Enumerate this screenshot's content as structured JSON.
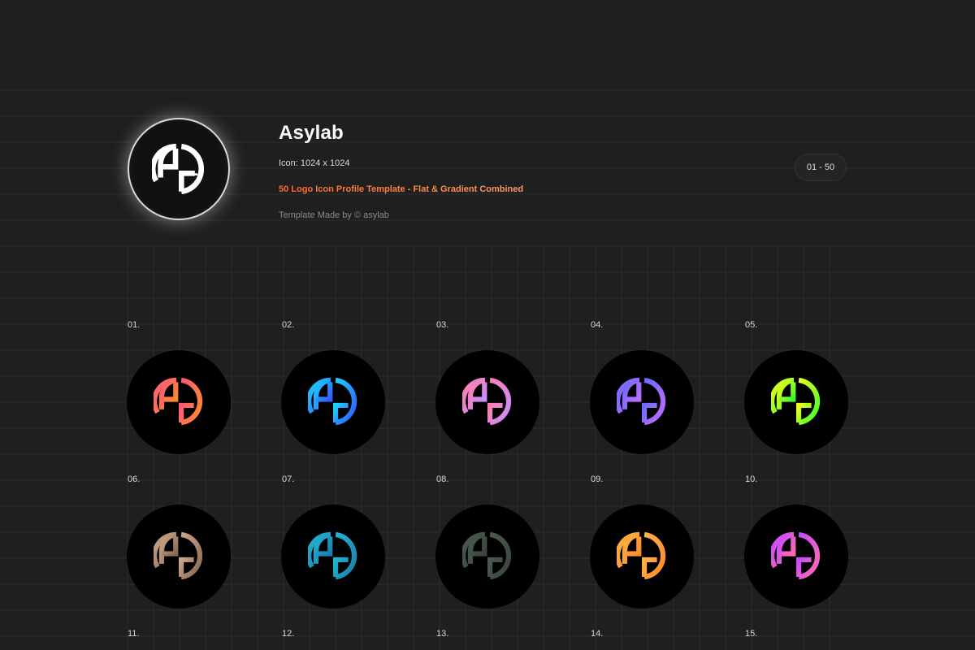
{
  "header": {
    "title": "Asylab",
    "icon_size": "Icon: 1024 x 1024",
    "subtitle": "50 Logo Icon Profile Template - Flat & Gradient Combined",
    "credit": "Template Made by © asylab",
    "range": "01 - 50"
  },
  "hero_logo": {
    "icon": "asylab-logo-icon",
    "color": "#ffffff"
  },
  "grid": {
    "background": "#1f1f1f",
    "items": [
      {
        "label": "01.",
        "icon": "asylab-logo-icon",
        "gradient": [
          "#ff5a7a",
          "#ff8a2a"
        ]
      },
      {
        "label": "02.",
        "icon": "asylab-logo-icon",
        "gradient": [
          "#1fd2ff",
          "#2f5bff"
        ]
      },
      {
        "label": "03.",
        "icon": "asylab-logo-icon",
        "gradient": [
          "#ff7fb0",
          "#c98cff"
        ]
      },
      {
        "label": "04.",
        "icon": "asylab-logo-icon",
        "gradient": [
          "#6a6cff",
          "#c06bff"
        ]
      },
      {
        "label": "05.",
        "icon": "asylab-logo-icon",
        "gradient": [
          "#f2ff1a",
          "#3cff2a"
        ]
      },
      {
        "label": "06.",
        "icon": "asylab-logo-icon",
        "gradient": [
          "#caa58a",
          "#8a6a54"
        ]
      },
      {
        "label": "07.",
        "icon": "asylab-logo-icon",
        "gradient": [
          "#1fb4d4",
          "#1a7fa8"
        ]
      },
      {
        "label": "08.",
        "icon": "asylab-logo-icon",
        "gradient": [
          "#4a5a4e",
          "#3a463d"
        ]
      },
      {
        "label": "09.",
        "icon": "asylab-logo-icon",
        "gradient": [
          "#ffb24a",
          "#ff8a2a"
        ]
      },
      {
        "label": "10.",
        "icon": "asylab-logo-icon",
        "gradient": [
          "#c64bff",
          "#ff6ab0"
        ]
      }
    ],
    "next_labels": [
      "11.",
      "12.",
      "13.",
      "14.",
      "15."
    ]
  }
}
